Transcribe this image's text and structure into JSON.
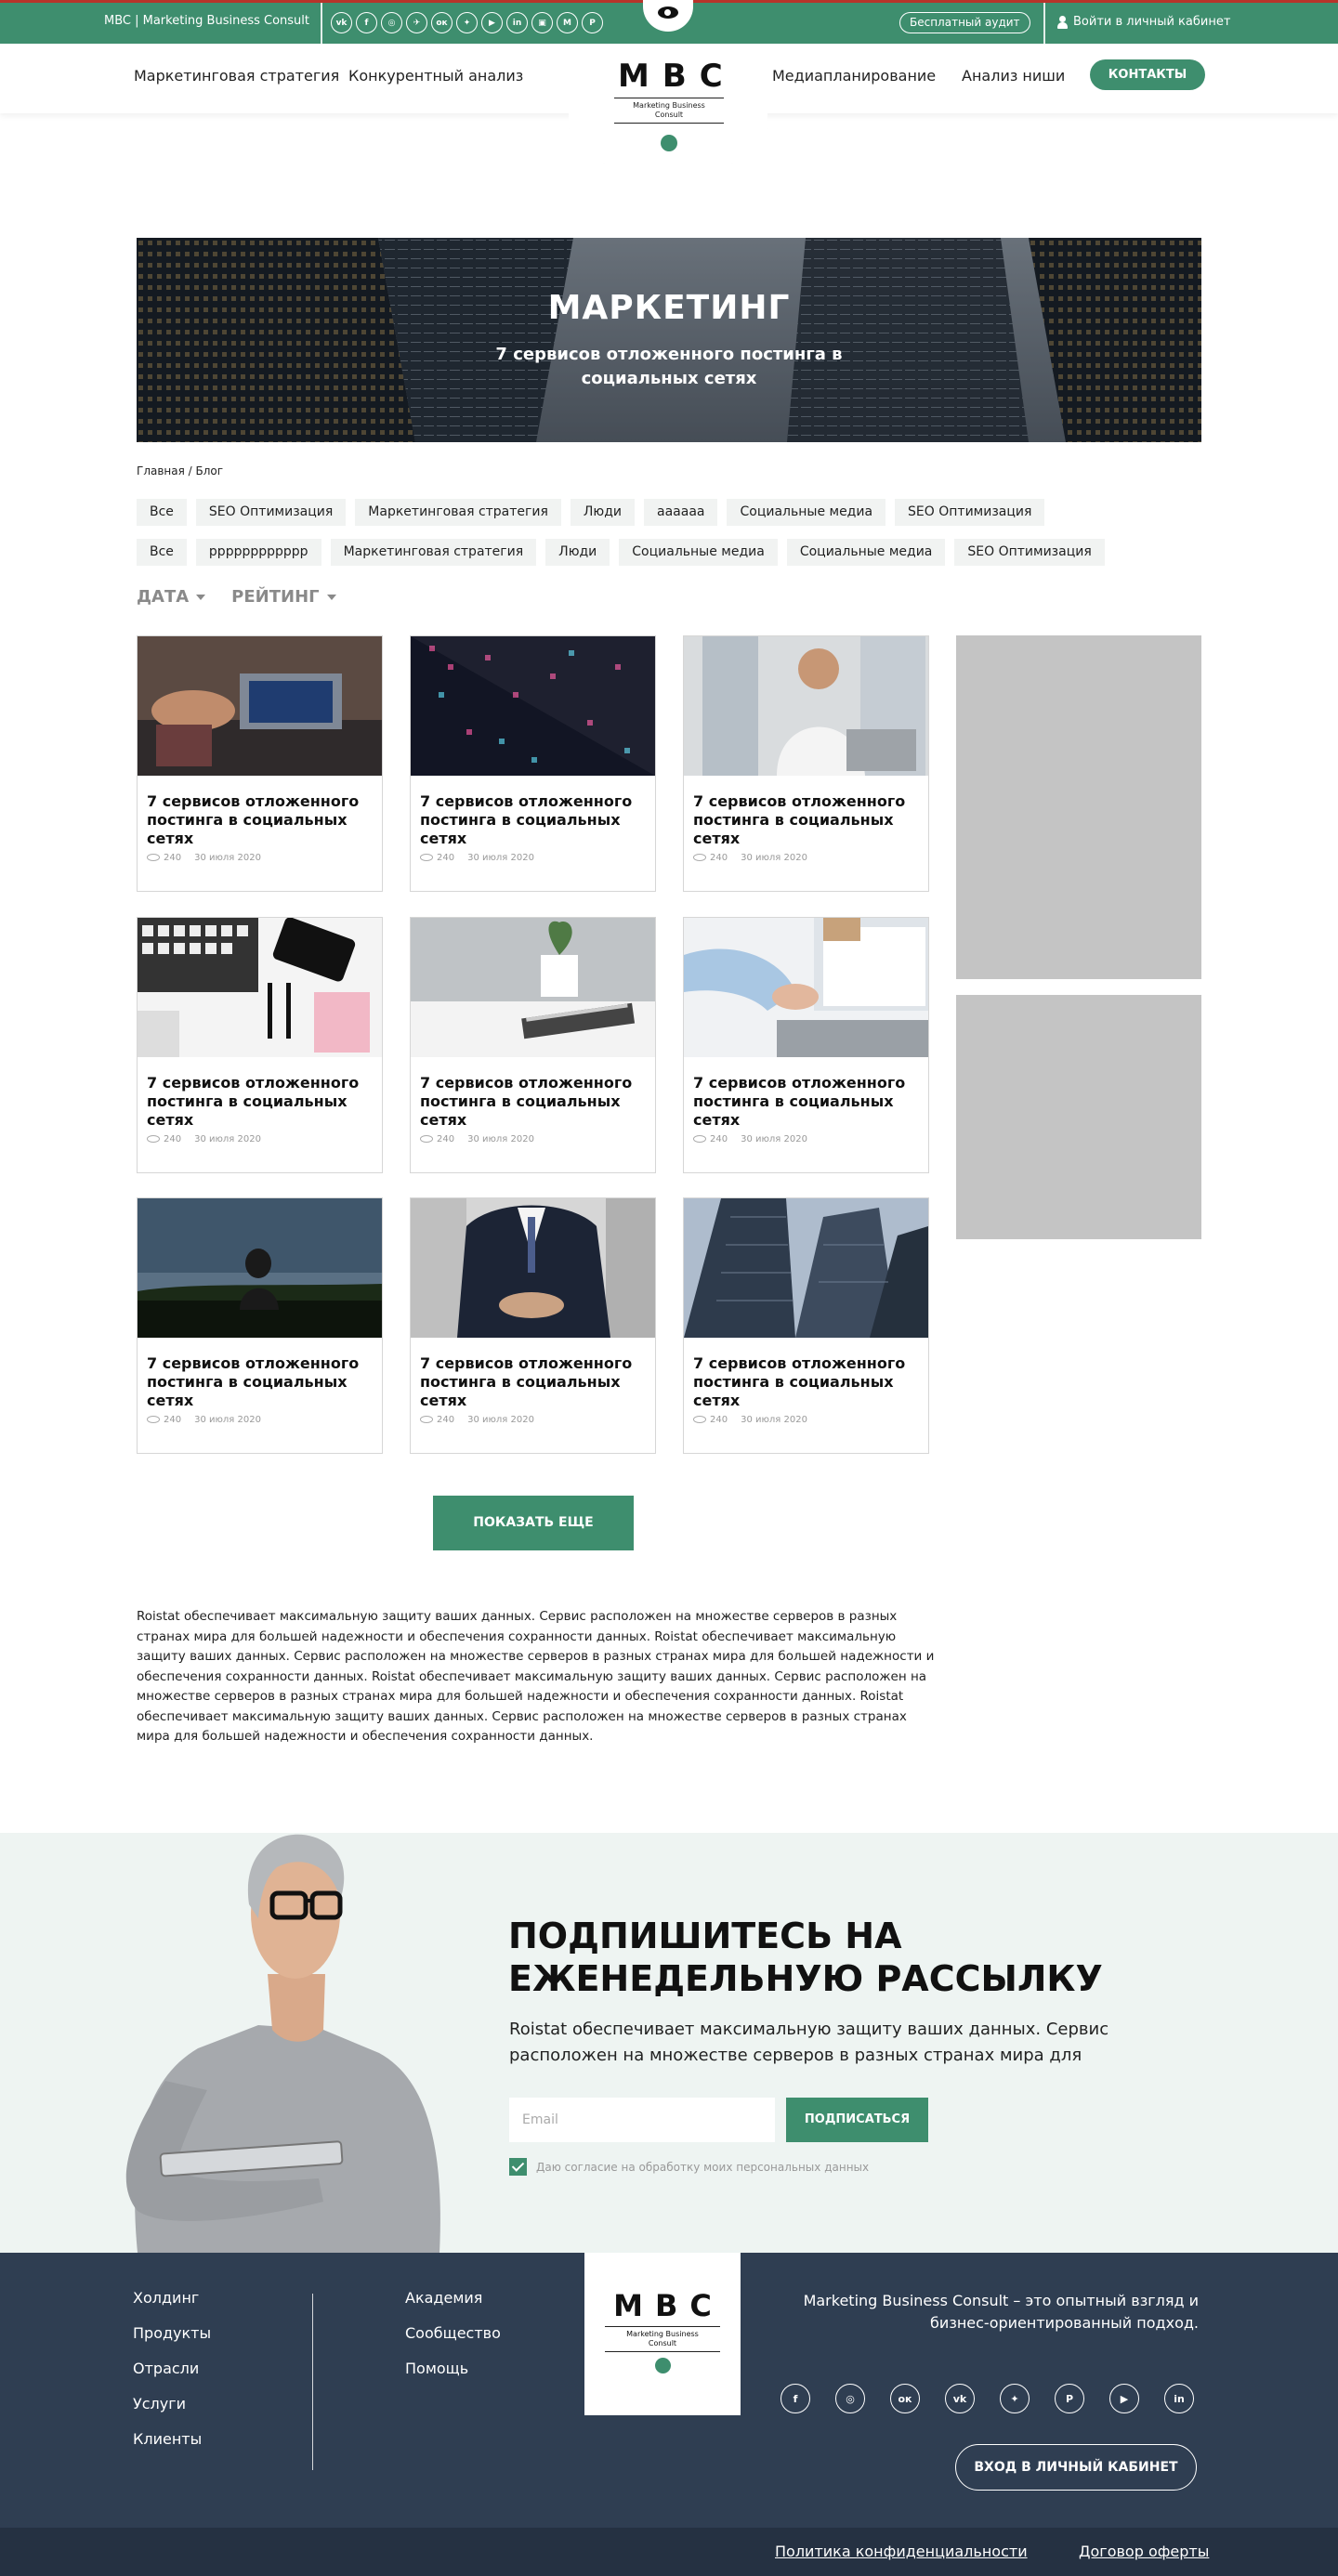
{
  "topbar": {
    "brand": "MBC | Marketing Business Consult",
    "socials": [
      "vk",
      "fb",
      "ig",
      "tg",
      "ok",
      "tw",
      "yt",
      "in",
      "ms",
      "mm",
      "pn"
    ],
    "social_glyphs": [
      "vk",
      "f",
      "◎",
      "✈",
      "ок",
      "✦",
      "▶",
      "in",
      "▣",
      "M",
      "P"
    ],
    "audit": "Бесплатный аудит",
    "login": "Войти в личный кабинет",
    "color": "#3e8e6e",
    "accent_stripe": "#b8332a"
  },
  "nav": {
    "items": [
      "Маркетинговая стратегия",
      "Конкурентный анализ",
      "Медиапланирование",
      "Анализ ниши"
    ],
    "contacts": "КОНТАКТЫ"
  },
  "logo": {
    "mark": "MBC",
    "sub1": "Marketing Business",
    "sub2": "Consult"
  },
  "hero": {
    "title": "МАРКЕТИНГ",
    "subtitle": "7 сервисов отложенного постинга в социальных сетях"
  },
  "breadcrumbs": "Главная / Блог",
  "tags_row1": [
    "Все",
    "SEO Оптимизация",
    "Маркетинговая стратегия",
    "Люди",
    "аааааа",
    "Социальные медиа",
    "SEO Оптимизация"
  ],
  "tags_row2": [
    "Все",
    "рррррррррррр",
    "Маркетинговая стратегия",
    "Люди",
    "Социальные медиа",
    "Социальные медиа",
    "SEO Оптимизация"
  ],
  "sort": {
    "date": "ДАТА",
    "rating": "РЕЙТИНГ"
  },
  "cards": [
    {
      "title": "7 сервисов отложенного постинга в социальных сетях",
      "views": "240",
      "date": "30 июля 2020",
      "image": "meeting-laptop"
    },
    {
      "title": "7 сервисов отложенного постинга в социальных сетях",
      "views": "240",
      "date": "30 июля 2020",
      "image": "night-building"
    },
    {
      "title": "7 сервисов отложенного постинга в социальных сетях",
      "views": "240",
      "date": "30 июля 2020",
      "image": "man-phone"
    },
    {
      "title": "7 сервисов отложенного постинга в социальных сетях",
      "views": "240",
      "date": "30 июля 2020",
      "image": "keyboard-desk"
    },
    {
      "title": "7 сервисов отложенного постинга в социальных сетях",
      "views": "240",
      "date": "30 июля 2020",
      "image": "notebook-plant"
    },
    {
      "title": "7 сервисов отложенного постинга в социальных сетях",
      "views": "240",
      "date": "30 июля 2020",
      "image": "laptop-hands"
    },
    {
      "title": "7 сервисов отложенного постинга в социальных сетях",
      "views": "240",
      "date": "30 июля 2020",
      "image": "field-person"
    },
    {
      "title": "7 сервисов отложенного постинга в социальных сетях",
      "views": "240",
      "date": "30 июля 2020",
      "image": "suit-man"
    },
    {
      "title": "7 сервисов отложенного постинга в социальных сетях",
      "views": "240",
      "date": "30 июля 2020",
      "image": "skyscrapers"
    }
  ],
  "show_more": "ПОКАЗАТЬ ЕЩЕ",
  "seo_text": "Roistat обеспечивает максимальную защиту ваших данных. Сервис расположен на множестве серверов в разных странах мира для большей надежности и обеспечения сохранности данных. Roistat обеспечивает максимальную защиту ваших данных. Сервис расположен на множестве серверов в разных странах мира для большей надежности и обеспечения сохранности данных. Roistat обеспечивает максимальную защиту ваших данных. Сервис расположен на множестве серверов в разных странах мира для большей надежности и обеспечения сохранности данных. Roistat обеспечивает максимальную защиту ваших данных. Сервис расположен на множестве серверов в разных странах мира для большей надежности и обеспечения сохранности данных.",
  "subscribe": {
    "title": "ПОДПИШИТЕСЬ НА ЕЖЕНЕДЕЛЬНУЮ РАССЫЛКУ",
    "text": "Roistat обеспечивает максимальную защиту ваших данных. Сервис расположен на множестве серверов в разных странах мира для",
    "email_placeholder": "Email",
    "button": "ПОДПИСАТЬСЯ",
    "consent": "Даю согласие на обработку моих персональных данных"
  },
  "footer": {
    "col1": [
      "Холдинг",
      "Продукты",
      "Отрасли",
      "Услуги",
      "Клиенты"
    ],
    "col2": [
      "Академия",
      "Сообщество",
      "Помощь"
    ],
    "about": "Marketing Business Consult – это опытный взгляд и бизнес-ориентированный подход.",
    "socials": [
      "f",
      "◎",
      "ок",
      "vk",
      "✦",
      "P",
      "▶",
      "in"
    ],
    "cabinet": "ВХОД В ЛИЧНЫЙ КАБИНЕТ",
    "privacy": "Политика конфиденциальности",
    "offer": "Договор оферты"
  }
}
